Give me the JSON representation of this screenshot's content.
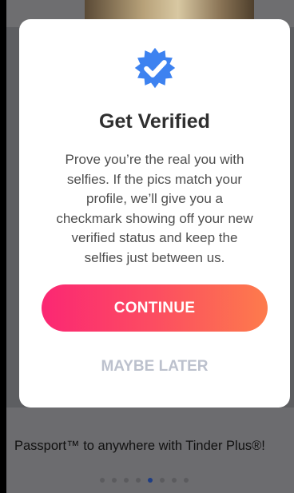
{
  "dialog": {
    "badge_icon": "verified-checkmark-badge-icon",
    "badge_color": "#3d82f0",
    "title": "Get Verified",
    "body_lines": [
      "Prove you’re the real you with",
      "selfies. If the pics match your",
      "profile, we’ll give you a",
      "checkmark showing off your new",
      "verified status and keep the",
      "selfies just between us."
    ],
    "continue_label": "CONTINUE",
    "maybe_later_label": "MAYBE LATER",
    "continue_gradient": [
      "#fb2773",
      "#fd7b4c"
    ]
  },
  "background": {
    "promo_text": "Passport™ to anywhere with Tinder Plus®!",
    "carousel": {
      "count": 8,
      "active_index": 4
    }
  }
}
